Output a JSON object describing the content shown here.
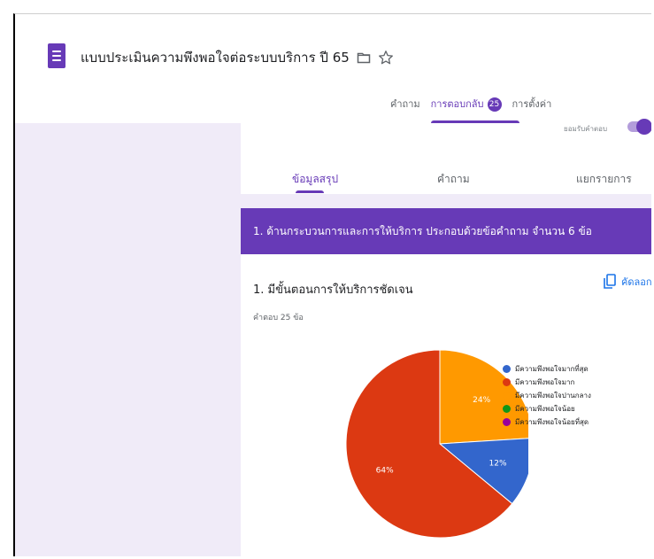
{
  "form": {
    "title": "แบบประเมินความพึงพอใจต่อระบบบริการ ปี 65"
  },
  "top_tabs": {
    "questions": "คำถาม",
    "responses": "การตอบกลับ",
    "responses_count": "25",
    "settings": "การตั้งค่า"
  },
  "accepting": {
    "label": "ยอมรับคำตอบ"
  },
  "sub_tabs": {
    "summary": "ข้อมูลสรุป",
    "question": "คำถาม",
    "individual": "แยกรายการ"
  },
  "section": {
    "title": "1. ด้านกระบวนการและการให้บริการ   ประกอบด้วยข้อคำถาม  จำนวน  6  ข้อ"
  },
  "question": {
    "title": "1. มีขั้นตอนการให้บริการชัดเจน",
    "response_count": "คำตอบ 25 ข้อ",
    "copy_label": "คัดลอก"
  },
  "colors": {
    "brand": "#673ab7",
    "background": "#f0ebf8"
  },
  "chart_data": {
    "type": "pie",
    "categories": [
      "มีความพึงพอใจมากที่สุด",
      "มีความพึงพอใจมาก",
      "มีความพึงพอใจปานกลาง",
      "มีความพึงพอใจน้อย",
      "มีความพึงพอใจน้อยที่สุด"
    ],
    "values": [
      12,
      64,
      24,
      0,
      0
    ],
    "data_labels": [
      "12%",
      "64%",
      "24%",
      "",
      ""
    ],
    "colors": [
      "#3366cc",
      "#dc3912",
      "#ff9900",
      "#109618",
      "#990099"
    ],
    "legend_position": "right"
  }
}
